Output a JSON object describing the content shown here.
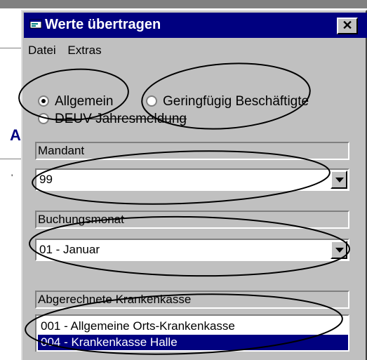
{
  "dialog": {
    "title": "Werte übertragen",
    "close_label": "✕"
  },
  "menu": {
    "items": [
      "Datei",
      "Extras"
    ]
  },
  "radios": [
    {
      "label": "Allgemein",
      "checked": true
    },
    {
      "label": "Geringfügig Beschäftigte",
      "checked": false
    },
    {
      "label": "DEUV Jahresmeldung",
      "checked": false
    }
  ],
  "mandant": {
    "label": "Mandant",
    "value": "99"
  },
  "buchungsmonat": {
    "label": "Buchungsmonat",
    "value": "01 - Januar"
  },
  "krankenkasse": {
    "label": "Abgerechnete Krankenkasse",
    "items": [
      "001 - Allgemeine Orts-Krankenkasse",
      "004 - Krankenkasse Halle"
    ],
    "selected_index": 1
  },
  "colors": {
    "titlebar": "#000080",
    "dialog_face": "#c0c0c0",
    "selection": "#000080"
  }
}
